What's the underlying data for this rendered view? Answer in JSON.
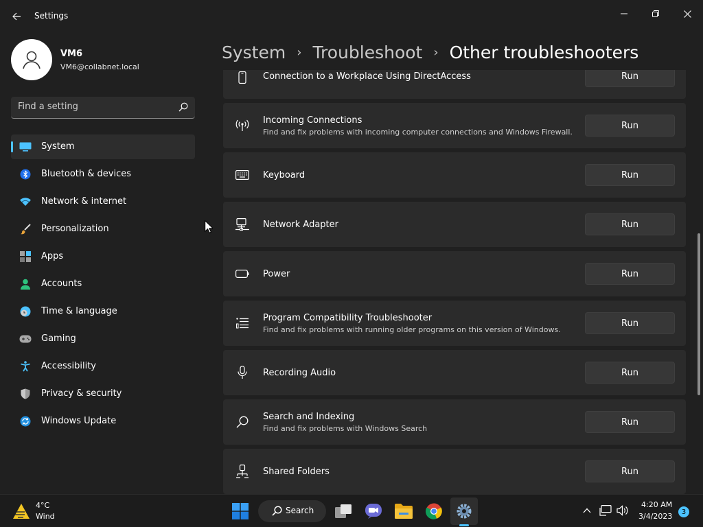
{
  "window": {
    "title": "Settings"
  },
  "profile": {
    "name": "VM6",
    "email": "VM6@collabnet.local"
  },
  "search": {
    "placeholder": "Find a setting"
  },
  "sidebar": {
    "items": [
      {
        "label": "System",
        "icon": "system-display-icon",
        "active": true
      },
      {
        "label": "Bluetooth & devices",
        "icon": "bluetooth-icon"
      },
      {
        "label": "Network & internet",
        "icon": "wifi-icon"
      },
      {
        "label": "Personalization",
        "icon": "brush-icon"
      },
      {
        "label": "Apps",
        "icon": "apps-icon"
      },
      {
        "label": "Accounts",
        "icon": "accounts-icon"
      },
      {
        "label": "Time & language",
        "icon": "clock-globe-icon"
      },
      {
        "label": "Gaming",
        "icon": "gamepad-icon"
      },
      {
        "label": "Accessibility",
        "icon": "accessibility-icon"
      },
      {
        "label": "Privacy & security",
        "icon": "shield-icon"
      },
      {
        "label": "Windows Update",
        "icon": "update-icon"
      }
    ]
  },
  "breadcrumb": {
    "items": [
      "System",
      "Troubleshoot",
      "Other troubleshooters"
    ]
  },
  "troubleshooters": [
    {
      "title": "Connection to a Workplace Using DirectAccess",
      "description": "",
      "icon": "phone-icon",
      "button": "Run"
    },
    {
      "title": "Incoming Connections",
      "description": "Find and fix problems with incoming computer connections and Windows Firewall.",
      "icon": "antenna-icon",
      "button": "Run"
    },
    {
      "title": "Keyboard",
      "description": "",
      "icon": "keyboard-icon",
      "button": "Run"
    },
    {
      "title": "Network Adapter",
      "description": "",
      "icon": "network-adapter-icon",
      "button": "Run"
    },
    {
      "title": "Power",
      "description": "",
      "icon": "battery-icon",
      "button": "Run"
    },
    {
      "title": "Program Compatibility Troubleshooter",
      "description": "Find and fix problems with running older programs on this version of Windows.",
      "icon": "list-icon",
      "button": "Run"
    },
    {
      "title": "Recording Audio",
      "description": "",
      "icon": "microphone-icon",
      "button": "Run"
    },
    {
      "title": "Search and Indexing",
      "description": "Find and fix problems with Windows Search",
      "icon": "search-icon",
      "button": "Run"
    },
    {
      "title": "Shared Folders",
      "description": "",
      "icon": "shared-folder-icon",
      "button": "Run"
    }
  ],
  "taskbar": {
    "weather_temp": "4°C",
    "weather_condition": "Wind",
    "search_label": "Search",
    "time": "4:20 AM",
    "date": "3/4/2023",
    "notification_count": "3"
  },
  "colors": {
    "accent": "#4cc2ff",
    "background": "#202020",
    "card": "#2b2b2b"
  }
}
